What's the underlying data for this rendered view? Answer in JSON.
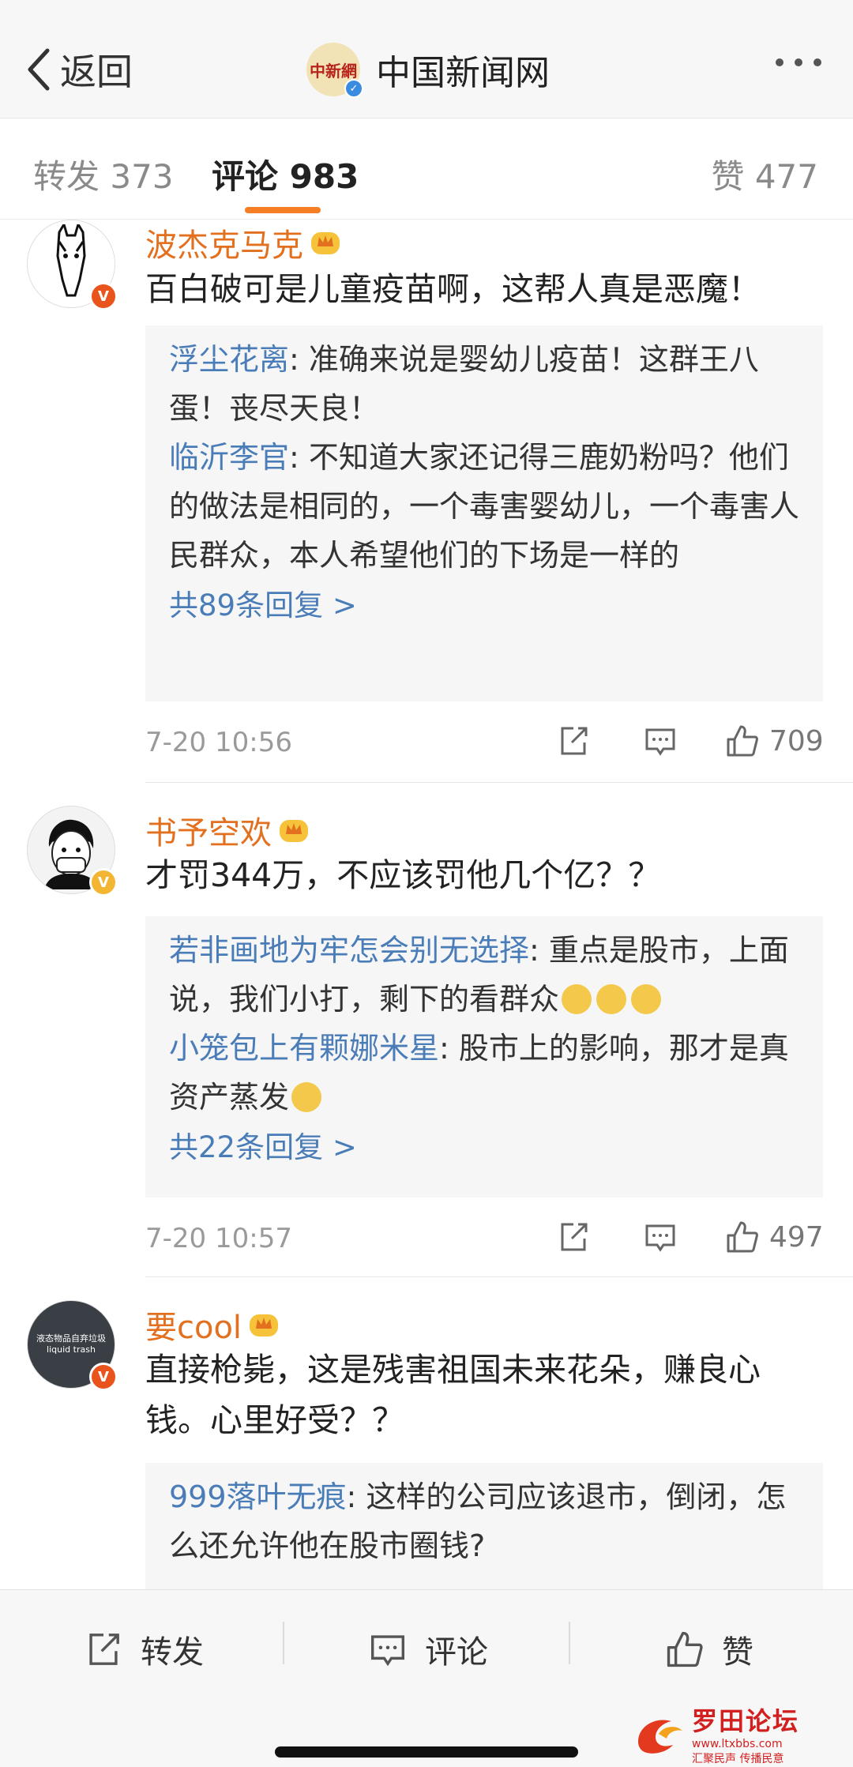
{
  "header": {
    "back_label": "返回",
    "account_name": "中国新闻网",
    "logo_text": "中新網"
  },
  "tabs": {
    "repost": "转发 373",
    "comment": "评论 983",
    "like": "赞 477"
  },
  "comments": [
    {
      "user": "波杰克马克",
      "text": "百白破可是儿童疫苗啊，这帮人真是恶魔！",
      "replies": [
        {
          "name": "浮尘花离",
          "text": ": 准确来说是婴幼儿疫苗！这群王八蛋！丧尽天良！"
        },
        {
          "name": "临沂李官",
          "text": ": 不知道大家还记得三鹿奶粉吗？他们的做法是相同的，一个毒害婴幼儿，一个毒害人民群众，本人希望他们的下场是一样的"
        }
      ],
      "more_replies": "共89条回复 >",
      "time": "7-20 10:56",
      "likes": "709"
    },
    {
      "user": "书予空欢",
      "text": "才罚344万，不应该罚他几个亿？？",
      "replies": [
        {
          "name": "若非画地为牢怎会别无选择",
          "text": ": 重点是股市，上面说，我们小打，剩下的看群众"
        },
        {
          "name": "小笼包上有颗娜米星",
          "text": ": 股市上的影响，那才是真资产蒸发"
        }
      ],
      "more_replies": "共22条回复 >",
      "time": "7-20 10:57",
      "likes": "497"
    },
    {
      "user": "要cool",
      "text": "直接枪毙，这是残害祖国未来花朵，赚良心钱。心里好受？？",
      "avatar_text": "液态物品自弃垃圾 liquid trash",
      "replies": [
        {
          "name": "999落叶无痕",
          "text": ": 这样的公司应该退市，倒闭，怎么还允许他在股市圈钱?"
        }
      ]
    }
  ],
  "bottom_bar": {
    "repost": "转发",
    "comment": "评论",
    "like": "赞"
  },
  "watermark": {
    "title": "罗田论坛",
    "url": "www.ltxbbs.com",
    "slogan": "汇聚民声 传播民意"
  },
  "colors": {
    "accent_orange": "#f57d23",
    "username_orange": "#e2701e",
    "reply_name_blue": "#4a7db8"
  }
}
